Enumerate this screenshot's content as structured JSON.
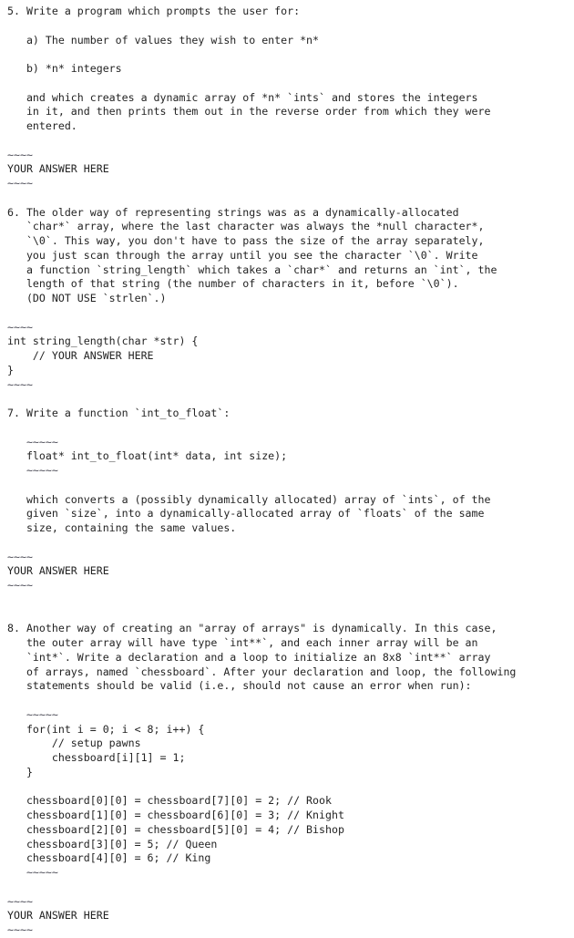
{
  "document": {
    "kind": "programming-exercise-worksheet",
    "language": "C",
    "answer_placeholder": "YOUR ANSWER HERE",
    "tilde_fence_short": "~~~~",
    "tilde_fence_long": "~~~~~",
    "text_color": "#232323",
    "fence_color": "#4a4a55",
    "background_color": "#ffffff"
  },
  "questions": [
    {
      "number": "5.",
      "prompt_lines": [
        "5. Write a program which prompts the user for:",
        "",
        "   a) The number of values they wish to enter *n*",
        "",
        "   b) *n* integers",
        "",
        "   and which creates a dynamic array of *n* `ints` and stores the integers",
        "   in it, and then prints them out in the reverse order from which they were",
        "   entered."
      ],
      "answer_fence_open": "~~~~",
      "answer_text": "YOUR ANSWER HERE",
      "answer_fence_close": "~~~~"
    },
    {
      "number": "6.",
      "prompt_lines": [
        "6. The older way of representing strings was as a dynamically-allocated",
        "   `char*` array, where the last character was always the *null character*,",
        "   `\\0`. This way, you don't have to pass the size of the array separately,",
        "   you just scan through the array until you see the character `\\0`. Write",
        "   a function `string_length` which takes a `char*` and returns an `int`, the",
        "   length of that string (the number of characters in it, before `\\0`).",
        "   (DO NOT USE `strlen`.)"
      ],
      "answer_fence_open": "~~~~",
      "answer_code_lines": [
        "int string_length(char *str) {",
        "    // YOUR ANSWER HERE",
        "}"
      ],
      "answer_fence_close": "~~~~"
    },
    {
      "number": "7.",
      "prompt_lines": [
        "7. Write a function `int_to_float`:"
      ],
      "signature_fence_open": "~~~~~",
      "signature_lines": [
        "   float* int_to_float(int* data, int size);"
      ],
      "signature_fence_close": "~~~~~",
      "description_lines": [
        "   which converts a (possibly dynamically allocated) array of `ints`, of the",
        "   given `size`, into a dynamically-allocated array of `floats` of the same",
        "   size, containing the same values."
      ],
      "answer_fence_open": "~~~~",
      "answer_text": "YOUR ANSWER HERE",
      "answer_fence_close": "~~~~"
    },
    {
      "number": "8.",
      "prompt_lines": [
        "8. Another way of creating an \"array of arrays\" is dynamically. In this case,",
        "   the outer array will have type `int**`, and each inner array will be an",
        "   `int*`. Write a declaration and a loop to initialize an 8x8 `int**` array",
        "   of arrays, named `chessboard`. After your declaration and loop, the following",
        "   statements should be valid (i.e., should not cause an error when run):"
      ],
      "example_fence_open": "~~~~~",
      "example_code_lines": [
        "   for(int i = 0; i < 8; i++) {",
        "       // setup pawns",
        "       chessboard[i][1] = 1;",
        "   }",
        "",
        "   chessboard[0][0] = chessboard[7][0] = 2; // Rook",
        "   chessboard[1][0] = chessboard[6][0] = 3; // Knight",
        "   chessboard[2][0] = chessboard[5][0] = 4; // Bishop",
        "   chessboard[3][0] = 5; // Queen",
        "   chessboard[4][0] = 6; // King"
      ],
      "example_fence_close": "~~~~~",
      "answer_fence_open": "~~~~",
      "answer_text": "YOUR ANSWER HERE",
      "answer_fence_close": "~~~~"
    }
  ],
  "indents": {
    "fence_short_prefix": "",
    "fence_long_prefix": "   "
  }
}
